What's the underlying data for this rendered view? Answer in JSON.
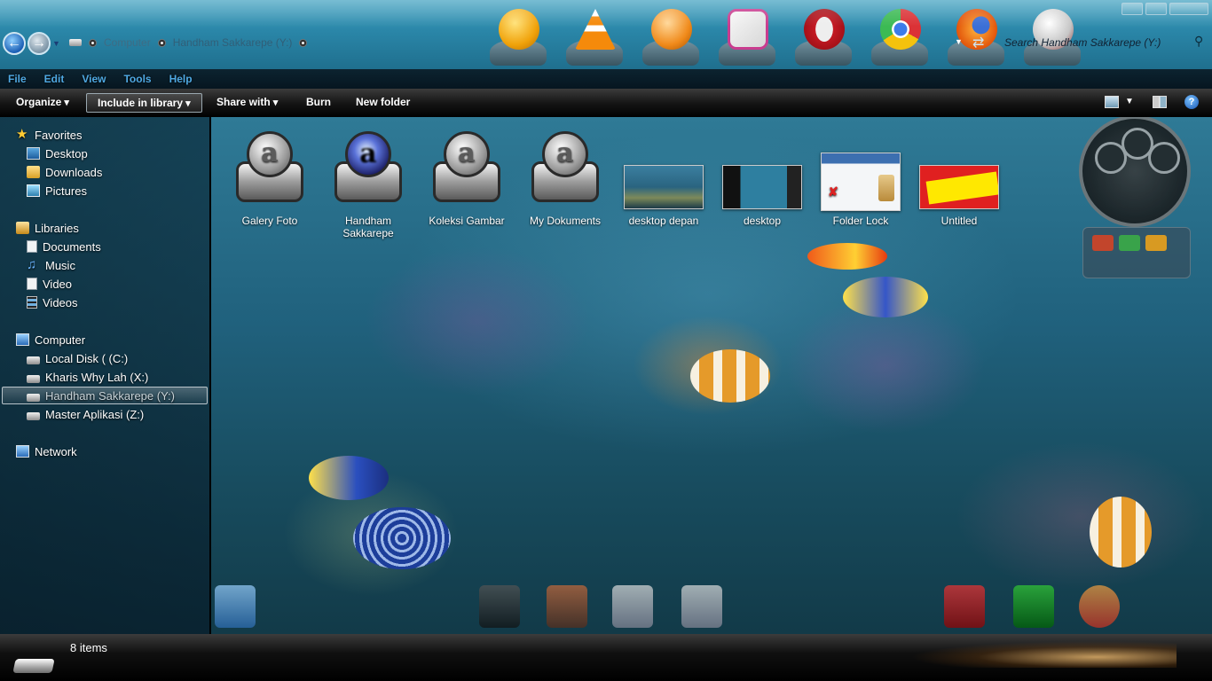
{
  "window": {
    "address": {
      "crumbs": [
        "Computer",
        "Handham Sakkarepe (Y:)"
      ]
    },
    "search_placeholder": "Search Handham Sakkarepe (Y:)"
  },
  "menubar": [
    "File",
    "Edit",
    "View",
    "Tools",
    "Help"
  ],
  "commandbar": {
    "organize": "Organize",
    "include_in_library": "Include in library",
    "share_with": "Share with",
    "burn": "Burn",
    "new_folder": "New folder"
  },
  "navigation": {
    "favorites": {
      "label": "Favorites",
      "items": [
        "Desktop",
        "Downloads",
        "Pictures"
      ]
    },
    "libraries": {
      "label": "Libraries",
      "items": [
        "Documents",
        "Music",
        "Video",
        "Videos"
      ]
    },
    "computer": {
      "label": "Computer",
      "items": [
        "Local Disk ( (C:)",
        "Kharis Why Lah (X:)",
        "Handham Sakkarepe (Y:)",
        "Master Aplikasi (Z:)"
      ]
    },
    "network": {
      "label": "Network"
    }
  },
  "files": [
    {
      "name": "Galery Foto",
      "kind": "drive-folder"
    },
    {
      "name": "Handham Sakkarepe",
      "kind": "drive-folder-special"
    },
    {
      "name": "Koleksi Gambar",
      "kind": "drive-folder"
    },
    {
      "name": "My Dokuments",
      "kind": "drive-folder"
    },
    {
      "name": "desktop depan",
      "kind": "image"
    },
    {
      "name": "desktop",
      "kind": "image"
    },
    {
      "name": "Folder Lock",
      "kind": "image"
    },
    {
      "name": "Untitled",
      "kind": "image"
    }
  ],
  "status": {
    "item_count": "8 items"
  },
  "colors": {
    "menu_text": "#4fa9e3",
    "accent": "#1b5fb5"
  }
}
